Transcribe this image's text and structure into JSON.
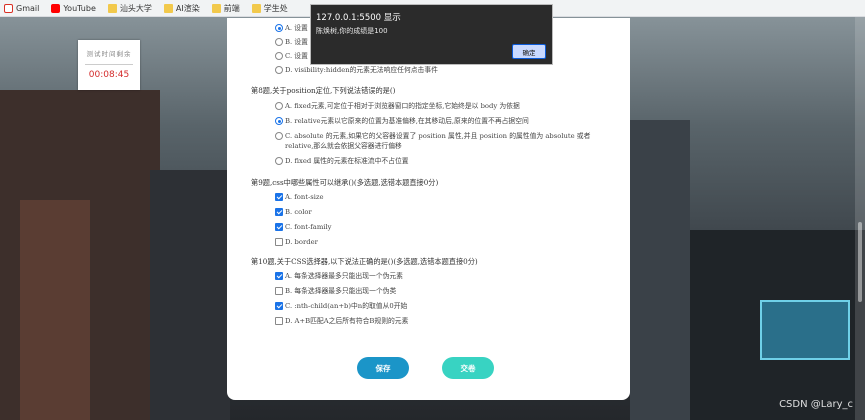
{
  "bookmarks": [
    {
      "label": "Gmail",
      "icon": "gmail-icon"
    },
    {
      "label": "YouTube",
      "icon": "youtube-icon"
    },
    {
      "label": "汕头大学",
      "icon": "folder-icon"
    },
    {
      "label": "AI渲染",
      "icon": "folder-icon"
    },
    {
      "label": "前端",
      "icon": "folder-icon"
    },
    {
      "label": "学生处",
      "icon": "folder-icon"
    }
  ],
  "timer": {
    "title": "测试时间剩余",
    "value": "00:08:45"
  },
  "alert": {
    "title": "127.0.0.1:5500 显示",
    "message": "陈焕树,你的成绩是100",
    "ok_label": "确定"
  },
  "quiz": {
    "q7_options": [
      {
        "label": "A. 设置",
        "checked": true
      },
      {
        "label": "B. 设置",
        "checked": false
      },
      {
        "label": "C. 设置",
        "checked": false
      },
      {
        "label": "D. visibility:hidden的元素无法响应任何点击事件",
        "checked": false
      }
    ],
    "q8": {
      "title": "第8题,关于position定位,下列说法错误的是()",
      "options": [
        {
          "label": "A. fixed元素,可定位于相对于浏览器窗口的指定坐标,它始终是以 body 为依据",
          "checked": false
        },
        {
          "label": "B. relative元素以它原来的位置为基准偏移,在其移动后,原来的位置不再占据空间",
          "checked": true
        },
        {
          "label": "C. absolute 的元素,如果它的父容器设置了 position 属性,并且 position 的属性值为 absolute 或者 relative,那么就会依据父容器进行偏移",
          "checked": false
        },
        {
          "label": "D. fixed 属性的元素在标准流中不占位置",
          "checked": false
        }
      ]
    },
    "q9": {
      "title": "第9题,css中哪些属性可以继承()(多选题,选错本题直接0分)",
      "options": [
        {
          "label": "A. font-size",
          "checked": true
        },
        {
          "label": "B. color",
          "checked": true
        },
        {
          "label": "C. font-family",
          "checked": true
        },
        {
          "label": "D. border",
          "checked": false
        }
      ]
    },
    "q10": {
      "title": "第10题,关于CSS选择器,以下说法正确的是()(多选题,选错本题直接0分)",
      "options": [
        {
          "label": "A. 每条选择器最多只能出现一个伪元素",
          "checked": true
        },
        {
          "label": "B. 每条选择器最多只能出现一个伪类",
          "checked": false
        },
        {
          "label": "C. :nth-child(an+b)中n的取值从0开始",
          "checked": true
        },
        {
          "label": "D. A+B匹配A之后所有符合B规则的元素",
          "checked": false
        }
      ]
    }
  },
  "buttons": {
    "save_label": "保存",
    "submit_label": "交卷"
  },
  "watermark": "CSDN @Lary_c",
  "colors": {
    "accent": "#1a73e8",
    "save": "#1b95c8",
    "submit": "#38d3c2",
    "timer_value": "#d42b2b"
  }
}
